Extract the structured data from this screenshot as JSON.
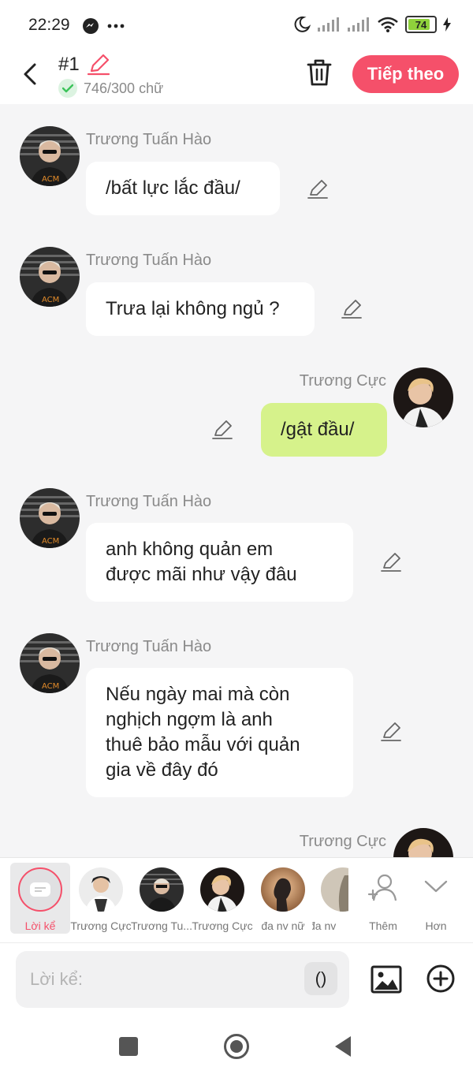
{
  "status_bar": {
    "time": "22:29",
    "battery": "74"
  },
  "header": {
    "title": "#1",
    "count": "746/300 chữ",
    "next_label": "Tiếp theo"
  },
  "messages": [
    {
      "speaker": "Trương Tuấn Hào",
      "lines": [
        "/bất lực lắc đầu/"
      ],
      "mine": false
    },
    {
      "speaker": "Trương Tuấn Hào",
      "lines": [
        "Trưa lại không ngủ ?"
      ],
      "mine": false
    },
    {
      "speaker": "Trương Cực",
      "lines": [
        "/gật đầu/"
      ],
      "mine": true
    },
    {
      "speaker": "Trương Tuấn Hào",
      "lines": [
        "anh không quản em",
        "được mãi như vậy đâu"
      ],
      "mine": false
    },
    {
      "speaker": "Trương Tuấn Hào",
      "lines": [
        "Nếu ngày mai mà còn",
        "nghịch ngợm là anh",
        "thuê bảo mẫu với quản",
        "gia về đây đó"
      ],
      "mine": false
    },
    {
      "speaker": "Trương Cực",
      "lines": [],
      "mine": true
    }
  ],
  "toolbar": {
    "narrator_label": "Lời kể",
    "characters": [
      "Trương Cực",
      "Trương Tu...",
      "Trương Cực",
      "đa nv nữ",
      "đa nv"
    ],
    "add_label": "Thêm",
    "more_label": "Hơn"
  },
  "input": {
    "placeholder": "Lời kể:",
    "paren_label": "()"
  },
  "colors": {
    "accent": "#f5506a",
    "my_bubble": "#d6f28b",
    "battery": "#8fd13b",
    "check": "#3cc35a"
  }
}
